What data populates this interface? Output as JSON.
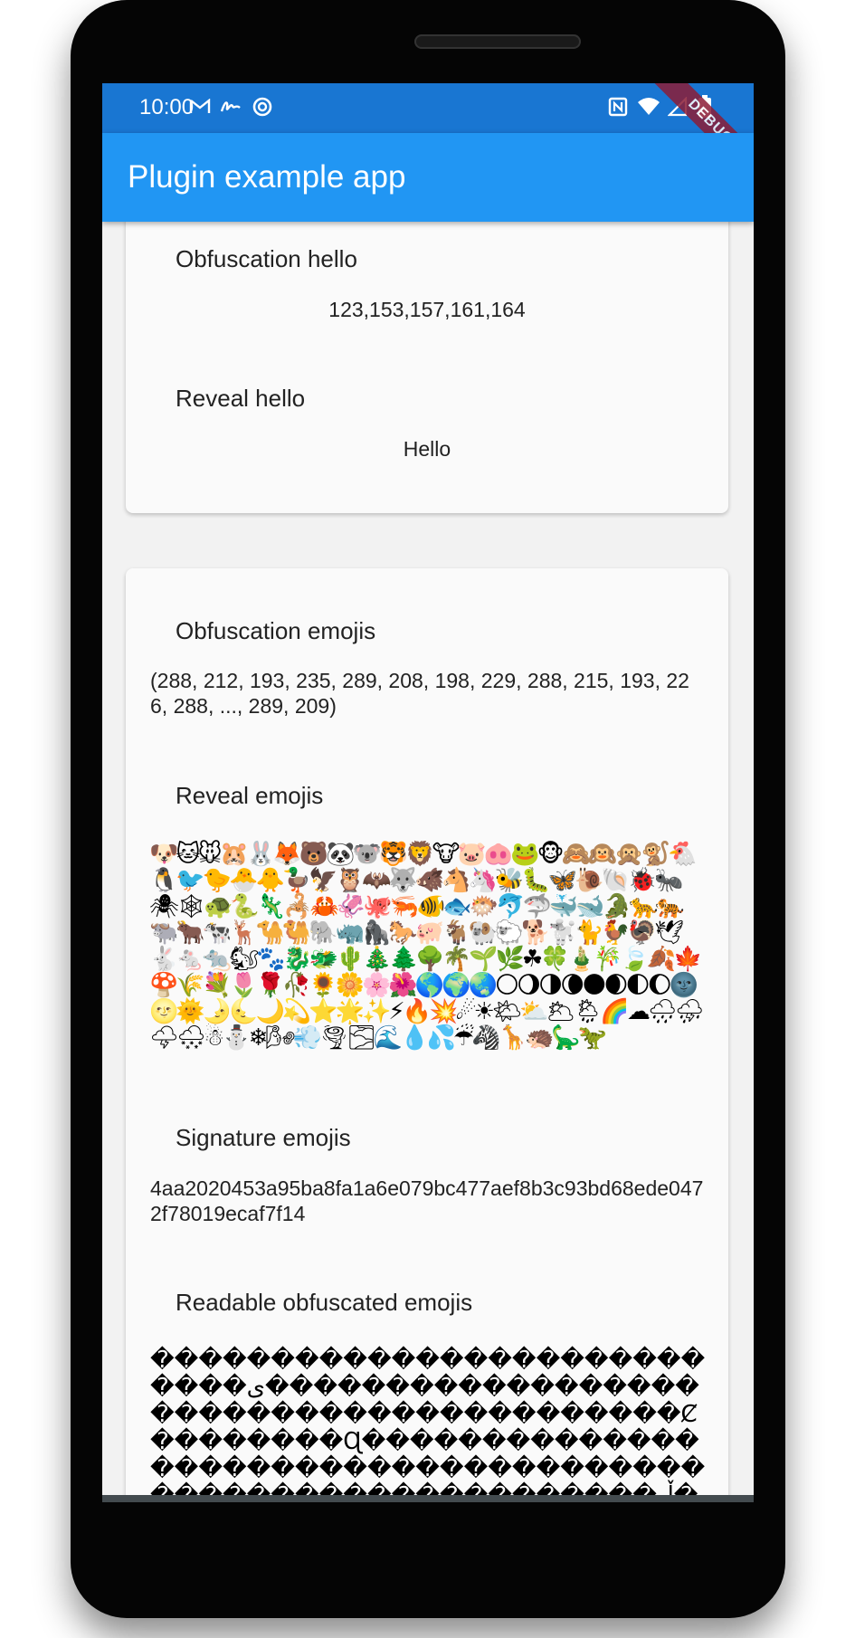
{
  "status_bar": {
    "time": "10:00",
    "left_icons": [
      "gmail-icon",
      "signature-icon",
      "sync-icon"
    ],
    "right_icons": [
      "nfc-icon",
      "wifi-icon",
      "signal-icon",
      "battery-icon"
    ],
    "debug_banner": "DEBUG"
  },
  "app_bar": {
    "title": "Plugin example app"
  },
  "card1": {
    "obfuscation_title": "Obfuscation hello",
    "obfuscation_value": "123,153,157,161,164",
    "reveal_title": "Reveal hello",
    "reveal_value": "Hello"
  },
  "card2": {
    "obfuscation_title": "Obfuscation emojis",
    "obfuscation_value": "(288, 212, 193, 235, 289, 208, 198, 229, 288, 215, 193, 226, 288, ..., 289, 209)",
    "reveal_title": "Reveal emojis",
    "reveal_value": "🐶🐱🐭🐹🐰🦊🐻🐼🐨🐯🦁🐮🐷🐽🐸🐵🙈🙉🙊🐒🐔🐧🐦🐤🐣🐥🦆🦅🦉🦇🐺🐗🐴🦄🐝🐛🦋🐌🐚🐞🐜🕷🕸🐢🐍🦎🦂🦀🦑🐙🦐🐠🐟🐡🐬🦈🐳🐋🐊🐆🐅🐃🐂🐄🦌🐪🐫🐘🦏🦍🐎🐖🐐🐏🐑🐕🐩🐈🐓🦃🕊🐇🐁🐀🐿🐾🐉🐲🌵🎄🌲🌳🌴🌱🌿☘🍀🎍🎋🍃🍂🍁🍄🌾💐🌷🌹🥀🌻🌼🌸🌺🌎🌍🌏🌕🌖🌗🌘🌑🌒🌓🌔🌚🌝🌞🌛🌜🌙💫⭐🌟✨⚡🔥💥☄☀🌤⛅🌥🌦🌈☁🌧⛈🌩🌨☃⛄❄🌬💨🌪🌫🌊💧💦☔🦓🦒🦔🦕🦖",
    "signature_title": "Signature emojis",
    "signature_value": "4aa2020453a95ba8fa1a6e079bc477aef8b3c93bd68ede0472f78019ecaf7f14",
    "readable_title": "Readable obfuscated emojis",
    "readable_value": "���������������������������ی����������������������������������������Ȼ��������Ɋ����������������������������������������������������������ڵ�����������������������������������"
  },
  "colors": {
    "status_bar": "#1976d2",
    "app_bar": "#2196f3",
    "card": "#fafafa",
    "nav_bar": "#434b4f"
  }
}
